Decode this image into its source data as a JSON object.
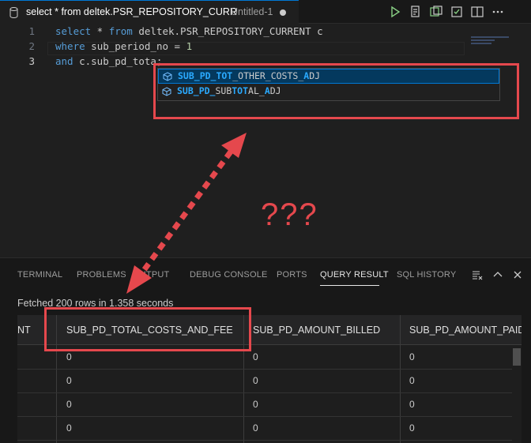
{
  "tab": {
    "title": "select * from deltek.PSR_REPOSITORY_CURR",
    "description": "Untitled-1"
  },
  "editor": {
    "lines": [
      {
        "number": "1",
        "parts": [
          [
            "kw",
            "select"
          ],
          [
            "",
            " * "
          ],
          [
            "kw",
            "from"
          ],
          [
            "",
            " deltek.PSR_REPOSITORY_CURRENT c"
          ]
        ]
      },
      {
        "number": "2",
        "parts": [
          [
            "kw",
            "where"
          ],
          [
            "",
            " sub_period_no = "
          ],
          [
            "num",
            "1"
          ]
        ]
      },
      {
        "number": "3",
        "parts": [
          [
            "kw",
            "and"
          ],
          [
            "",
            " c.sub_pd_tota;"
          ]
        ]
      }
    ]
  },
  "suggestions": [
    {
      "label": "SUB_PD_TOT_OTHER_COSTS_ADJ",
      "segments": [
        [
          "m",
          "SUB_PD_TOT"
        ],
        [
          "",
          "_OTHER_COSTS_"
        ],
        [
          "m",
          "A"
        ],
        [
          "",
          "DJ"
        ]
      ],
      "selected": true
    },
    {
      "label": "SUB_PD_SUBTOTAL_ADJ",
      "segments": [
        [
          "m",
          "SUB_PD_"
        ],
        [
          "",
          "SUB"
        ],
        [
          "m",
          "TOT"
        ],
        [
          "",
          "AL_"
        ],
        [
          "m",
          "A"
        ],
        [
          "",
          "DJ"
        ]
      ],
      "selected": false
    }
  ],
  "annotation": {
    "question": "???"
  },
  "panel": {
    "tabs": [
      {
        "label": "TERMINAL",
        "active": false
      },
      {
        "label": "PROBLEMS",
        "active": false
      },
      {
        "label": "OUTPUT",
        "active": false
      },
      {
        "label": "DEBUG CONSOLE",
        "active": false
      },
      {
        "label": "PORTS",
        "active": false
      },
      {
        "label": "QUERY RESULT",
        "active": true
      },
      {
        "label": "SQL HISTORY",
        "active": false
      }
    ],
    "status": "Fetched 200 rows in 1.358 seconds"
  },
  "grid": {
    "columns": [
      "NT",
      "SUB_PD_TOTAL_COSTS_AND_FEE",
      "SUB_PD_AMOUNT_BILLED",
      "SUB_PD_AMOUNT_PAID"
    ],
    "rows": [
      [
        "",
        "0",
        "0",
        "0"
      ],
      [
        "",
        "0",
        "0",
        "0"
      ],
      [
        "",
        "0",
        "0",
        "0"
      ],
      [
        "",
        "0",
        "0",
        "0"
      ]
    ]
  },
  "colors": {
    "accent": "#0078d4",
    "annotation": "#e5484d",
    "keyword": "#569cd6",
    "match": "#2aaaff"
  },
  "icons": [
    "database-icon",
    "run-icon",
    "explain-icon",
    "new-query-icon",
    "export-icon",
    "split-editor-icon",
    "more-icon",
    "symbol-field-icon",
    "clear-icon",
    "chevron-up-icon",
    "close-icon"
  ]
}
